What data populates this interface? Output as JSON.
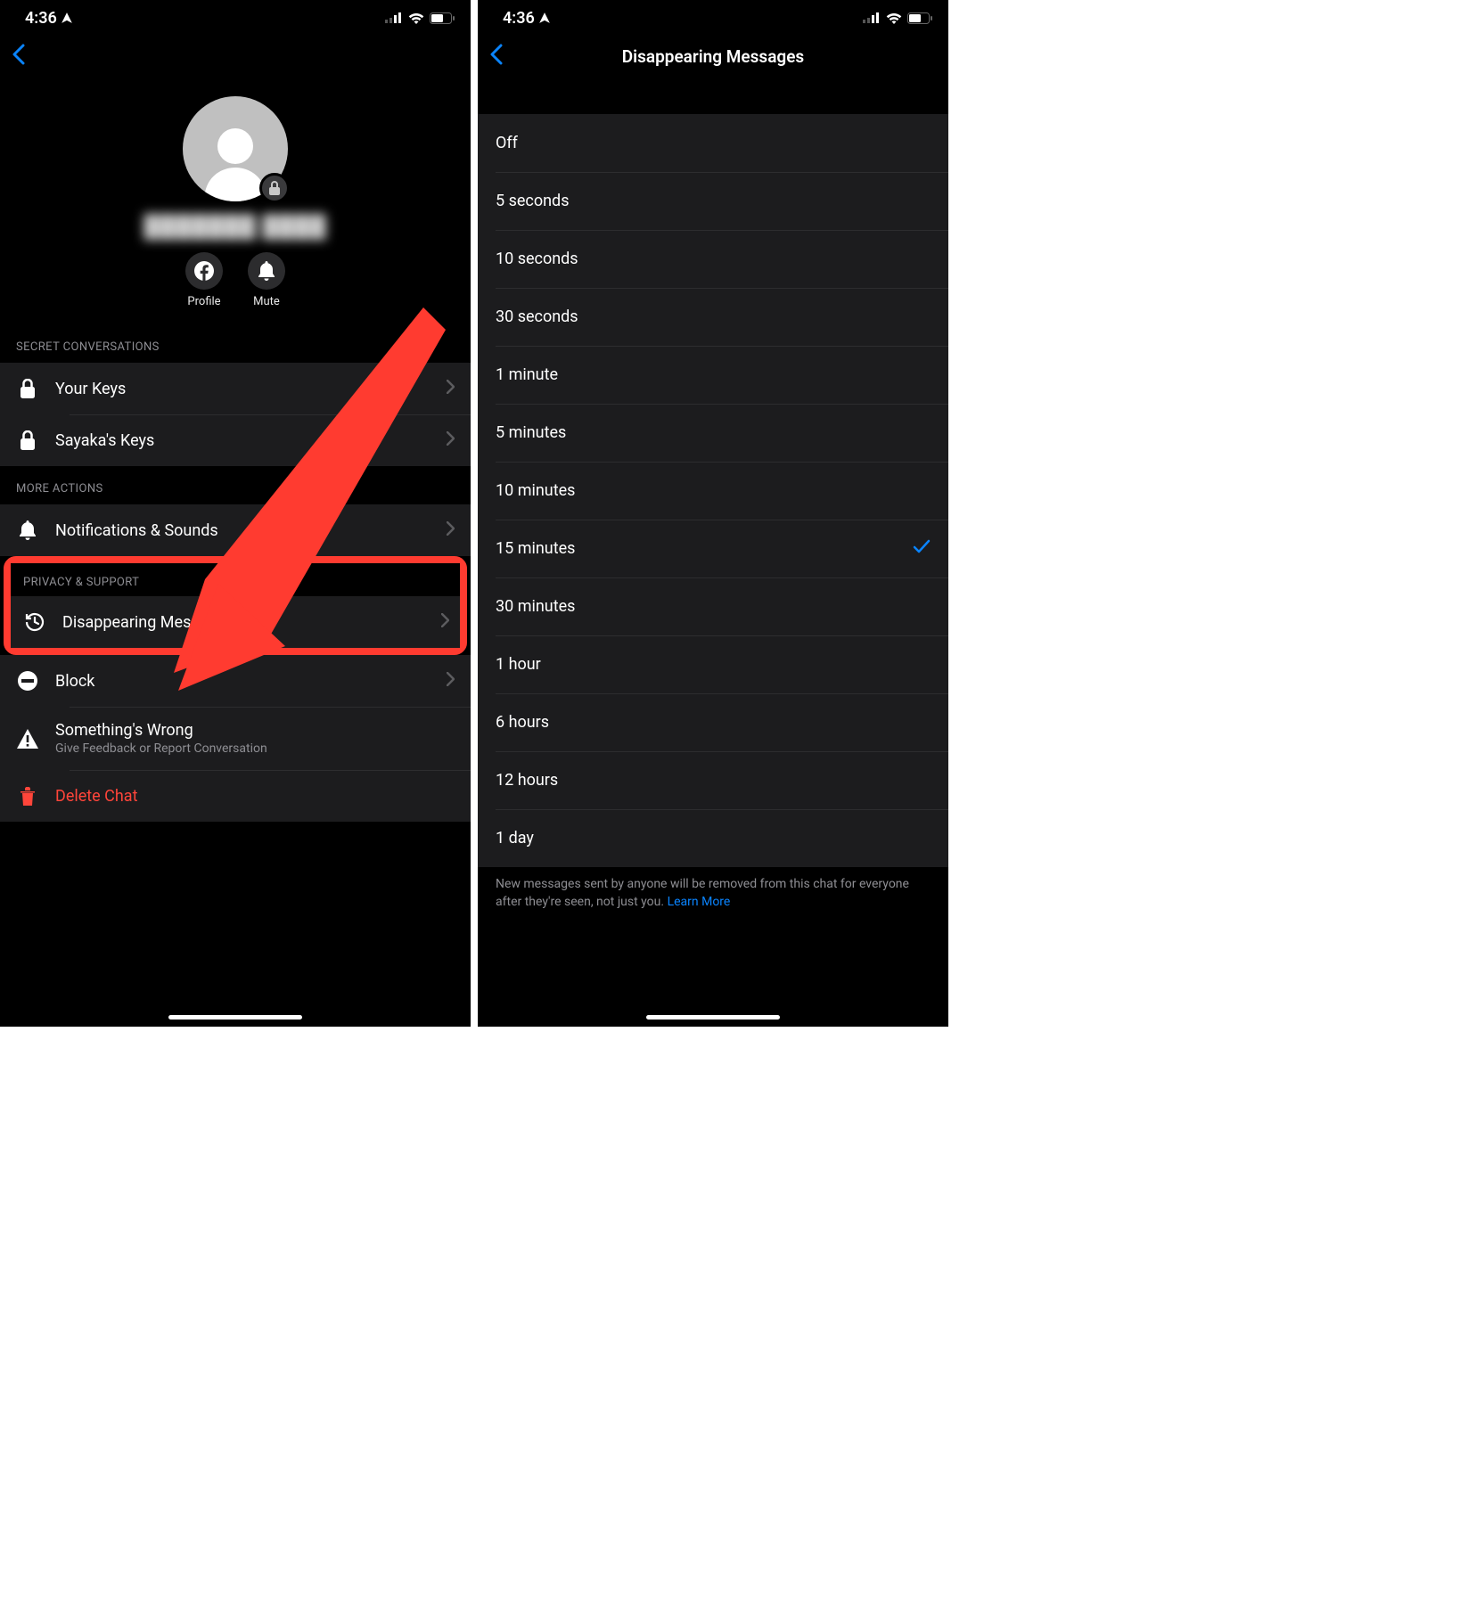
{
  "status_time": "4:36",
  "left": {
    "profile_name_redacted": "███████ ████",
    "actions": {
      "profile": "Profile",
      "mute": "Mute"
    },
    "section_secret": "SECRET CONVERSATIONS",
    "row_your_keys": "Your Keys",
    "row_sayakas_keys": "Sayaka's Keys",
    "section_more_actions": "MORE ACTIONS",
    "row_notifications": "Notifications & Sounds",
    "section_privacy": "PRIVACY & SUPPORT",
    "row_disappearing": "Disappearing Messages",
    "row_block": "Block",
    "row_wrong": "Something's Wrong",
    "row_wrong_sub": "Give Feedback or Report Conversation",
    "row_delete": "Delete Chat"
  },
  "right": {
    "title": "Disappearing Messages",
    "options": [
      "Off",
      "5 seconds",
      "10 seconds",
      "30 seconds",
      "1 minute",
      "5 minutes",
      "10 minutes",
      "15 minutes",
      "30 minutes",
      "1 hour",
      "6 hours",
      "12 hours",
      "1 day"
    ],
    "selected": "15 minutes",
    "footer": "New messages sent by anyone will be removed from this chat for everyone after they're seen, not just you. ",
    "learn_more": "Learn More"
  }
}
